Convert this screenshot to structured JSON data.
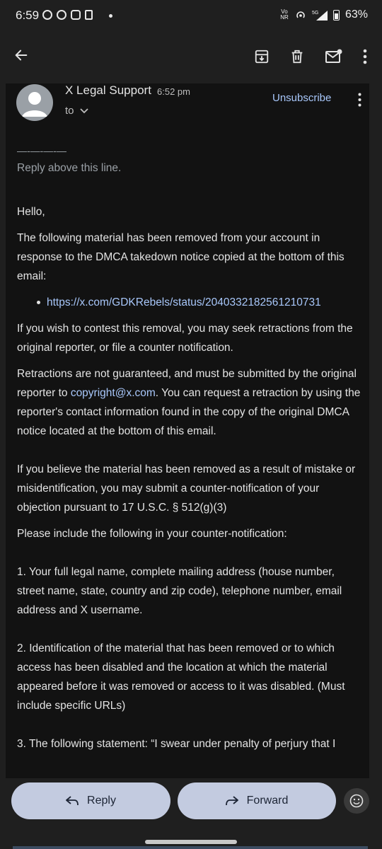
{
  "status_bar": {
    "time": "6:59",
    "network": "5G",
    "volte": "Vo NR",
    "battery": "63%"
  },
  "toolbar": {
    "back_icon": "arrow-left-icon",
    "archive_icon": "archive-icon",
    "delete_icon": "trash-icon",
    "unread_icon": "mark-unread-icon",
    "more_icon": "more-vertical-icon"
  },
  "email": {
    "sender": "X Legal Support",
    "time": "6:52 pm",
    "to_label": "to",
    "unsubscribe": "Unsubscribe",
    "separator": "—-—-—-—",
    "reply_above": "Reply above this line.",
    "greeting": "Hello,",
    "p1": "The following material has been removed from your account in response to the DMCA takedown notice copied at the bottom of this email:",
    "link1": "https://x.com/GDKRebels/status/2040332182561210731",
    "p2": "If you wish to contest this removal, you may seek retractions from the original reporter, or file a counter notification.",
    "p3_before": "Retractions are not guaranteed, and must be submitted by the original reporter to ",
    "p3_email": "copyright@x.com",
    "p3_after": ". You can request a retraction by using the reporter's contact information found in the copy of the original DMCA notice located at the bottom of this email.",
    "p4": "If you believe the material has been removed as a result of mistake or misidentification, you may submit a counter-notification of your objection pursuant to 17 U.S.C. § 512(g)(3)",
    "p5": "Please include the following in your counter-notification:",
    "item1": "1. Your full legal name, complete mailing address (house number, street name, state, country and zip code), telephone number, email address and X username.",
    "item2": "2. Identification of the material that has been removed or to which access has been disabled and the location at which the material appeared before it was removed or access to it was disabled. (Must include specific URLs)",
    "item3": "3. The following statement: “I swear under penalty of perjury that I"
  },
  "actions": {
    "reply": "Reply",
    "forward": "Forward"
  }
}
